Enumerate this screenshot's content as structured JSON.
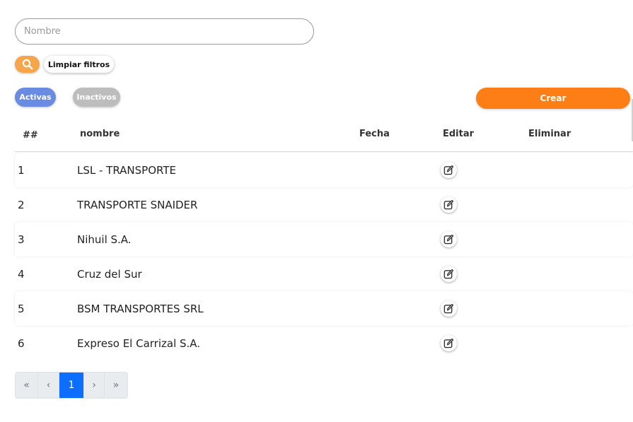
{
  "filters": {
    "name_placeholder": "Nombre",
    "name_value": "",
    "search_icon": "search-icon",
    "clear_label": "Limpiar filtros",
    "search_button_color": "#f7a54a"
  },
  "status_tabs": {
    "active_label": "Activas",
    "inactive_label": "Inactivos",
    "active_color": "#6a8be2",
    "inactive_color": "#bdbdbd"
  },
  "create": {
    "label": "Crear",
    "color": "#fd7e14"
  },
  "table": {
    "headers": {
      "id": "##",
      "name": "nombre",
      "date": "Fecha",
      "edit": "Editar",
      "delete": "Eliminar"
    },
    "rows": [
      {
        "id": "1",
        "name": "LSL - TRANSPORTE",
        "date": ""
      },
      {
        "id": "2",
        "name": "TRANSPORTE SNAIDER",
        "date": ""
      },
      {
        "id": "3",
        "name": "Nihuil S.A.",
        "date": ""
      },
      {
        "id": "4",
        "name": "Cruz del Sur",
        "date": ""
      },
      {
        "id": "5",
        "name": "BSM TRANSPORTES SRL",
        "date": ""
      },
      {
        "id": "6",
        "name": "Expreso El Carrizal S.A.",
        "date": ""
      }
    ],
    "edit_icon": "edit-icon"
  },
  "pagination": {
    "first": "«",
    "prev": "‹",
    "current": "1",
    "next": "›",
    "last": "»",
    "current_color": "#0d6efd"
  }
}
